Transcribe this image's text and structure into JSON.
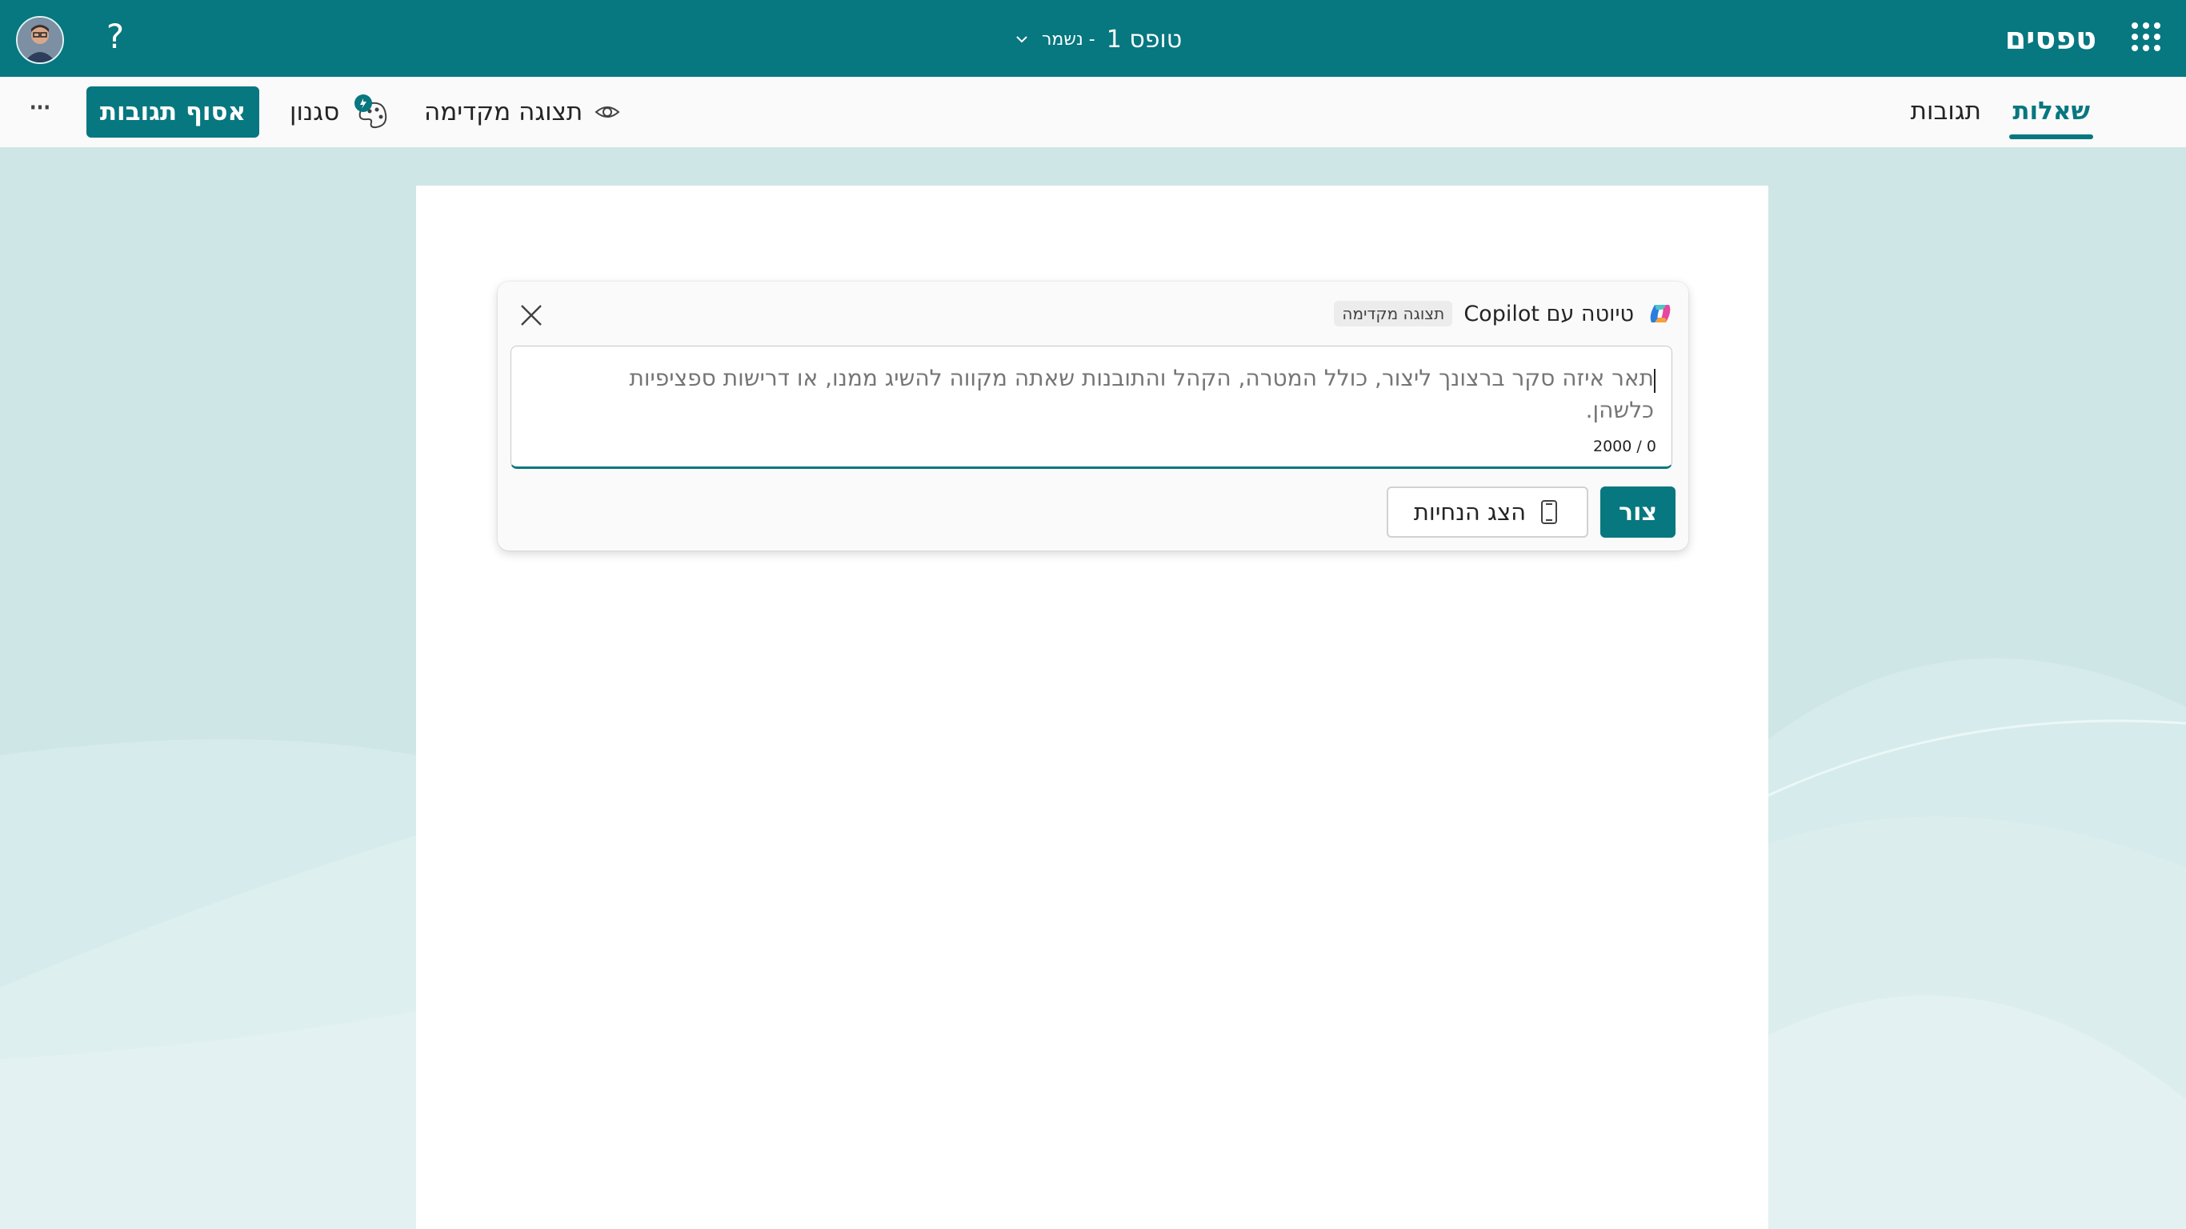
{
  "app": {
    "name": "טפסים"
  },
  "header": {
    "form_name": "טופס 1",
    "save_status": "- נשמר",
    "help_label": "?"
  },
  "tabs": [
    {
      "label": "שאלות",
      "selected": true
    },
    {
      "label": "תגובות",
      "selected": false
    }
  ],
  "toolbar": {
    "preview_label": "תצוגה מקדימה",
    "style_label": "סגנון",
    "collect_label": "אסוף תגובות",
    "more_label": "···"
  },
  "copilot": {
    "title": "טיוטה עם Copilot",
    "badge": "תצוגה מקדימה",
    "placeholder": "תאר איזה סקר ברצונך ליצור, כולל המטרה, הקהל והתובנות שאתה מקווה להשיג ממנו, או דרישות ספציפיות כלשהן.",
    "counter": "2000 / 0",
    "suggest_label": "הצג הנחיות",
    "create_label": "צור"
  },
  "colors": {
    "brand": "#077780",
    "canvas": "#cfe6e7"
  },
  "icons": {
    "waffle": "waffle-icon",
    "chevron": "chevron-down-icon",
    "eye": "eye-icon",
    "palette": "palette-icon",
    "close": "close-icon",
    "copilot": "copilot-logo-icon",
    "prompt": "tablet-icon"
  }
}
